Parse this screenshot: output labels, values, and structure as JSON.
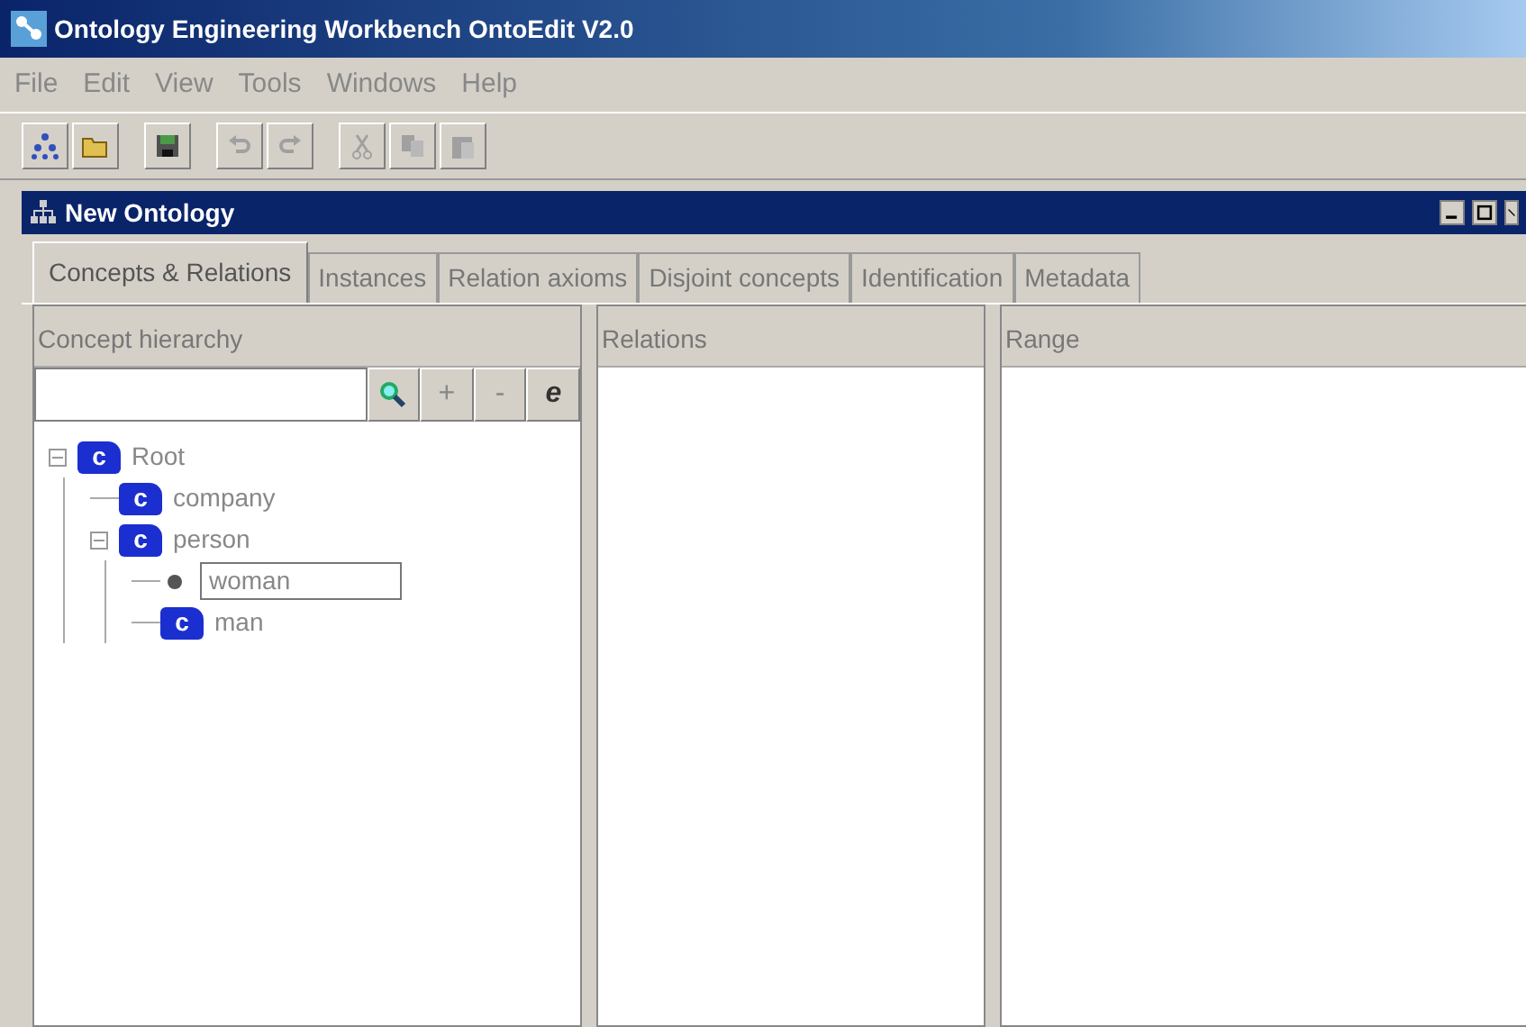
{
  "window": {
    "title": "Ontology Engineering Workbench OntoEdit V2.0"
  },
  "menu": [
    "File",
    "Edit",
    "View",
    "Tools",
    "Windows",
    "Help"
  ],
  "toolbar": [
    {
      "kind": "ontology"
    },
    {
      "kind": "open"
    },
    {
      "kind": "save"
    },
    {
      "kind": "undo"
    },
    {
      "kind": "redo"
    },
    {
      "kind": "cut"
    },
    {
      "kind": "copy"
    },
    {
      "kind": "paste"
    }
  ],
  "inner_window": {
    "title": "New Ontology"
  },
  "tabs": [
    {
      "label": "Concepts & Relations",
      "selected": true
    },
    {
      "label": "Instances",
      "selected": false
    },
    {
      "label": "Relation axioms",
      "selected": false
    },
    {
      "label": "Disjoint concepts",
      "selected": false
    },
    {
      "label": "Identification",
      "selected": false
    },
    {
      "label": "Metadata",
      "selected": false
    }
  ],
  "concept_panel": {
    "title": "Concept hierarchy",
    "buttons": [
      "+",
      "-",
      "e"
    ],
    "tree": [
      {
        "label": "Root",
        "kind": "concept",
        "badge": "c",
        "expanded": true,
        "children": [
          {
            "label": "company",
            "kind": "concept",
            "badge": "c"
          },
          {
            "label": "person",
            "kind": "concept",
            "badge": "c",
            "expanded": true,
            "children": [
              {
                "label": "woman",
                "kind": "editing"
              },
              {
                "label": "man",
                "kind": "concept",
                "badge": "c"
              }
            ]
          }
        ]
      }
    ]
  },
  "relations_panel": {
    "title": "Relations"
  },
  "range_panel": {
    "title": "Range"
  }
}
